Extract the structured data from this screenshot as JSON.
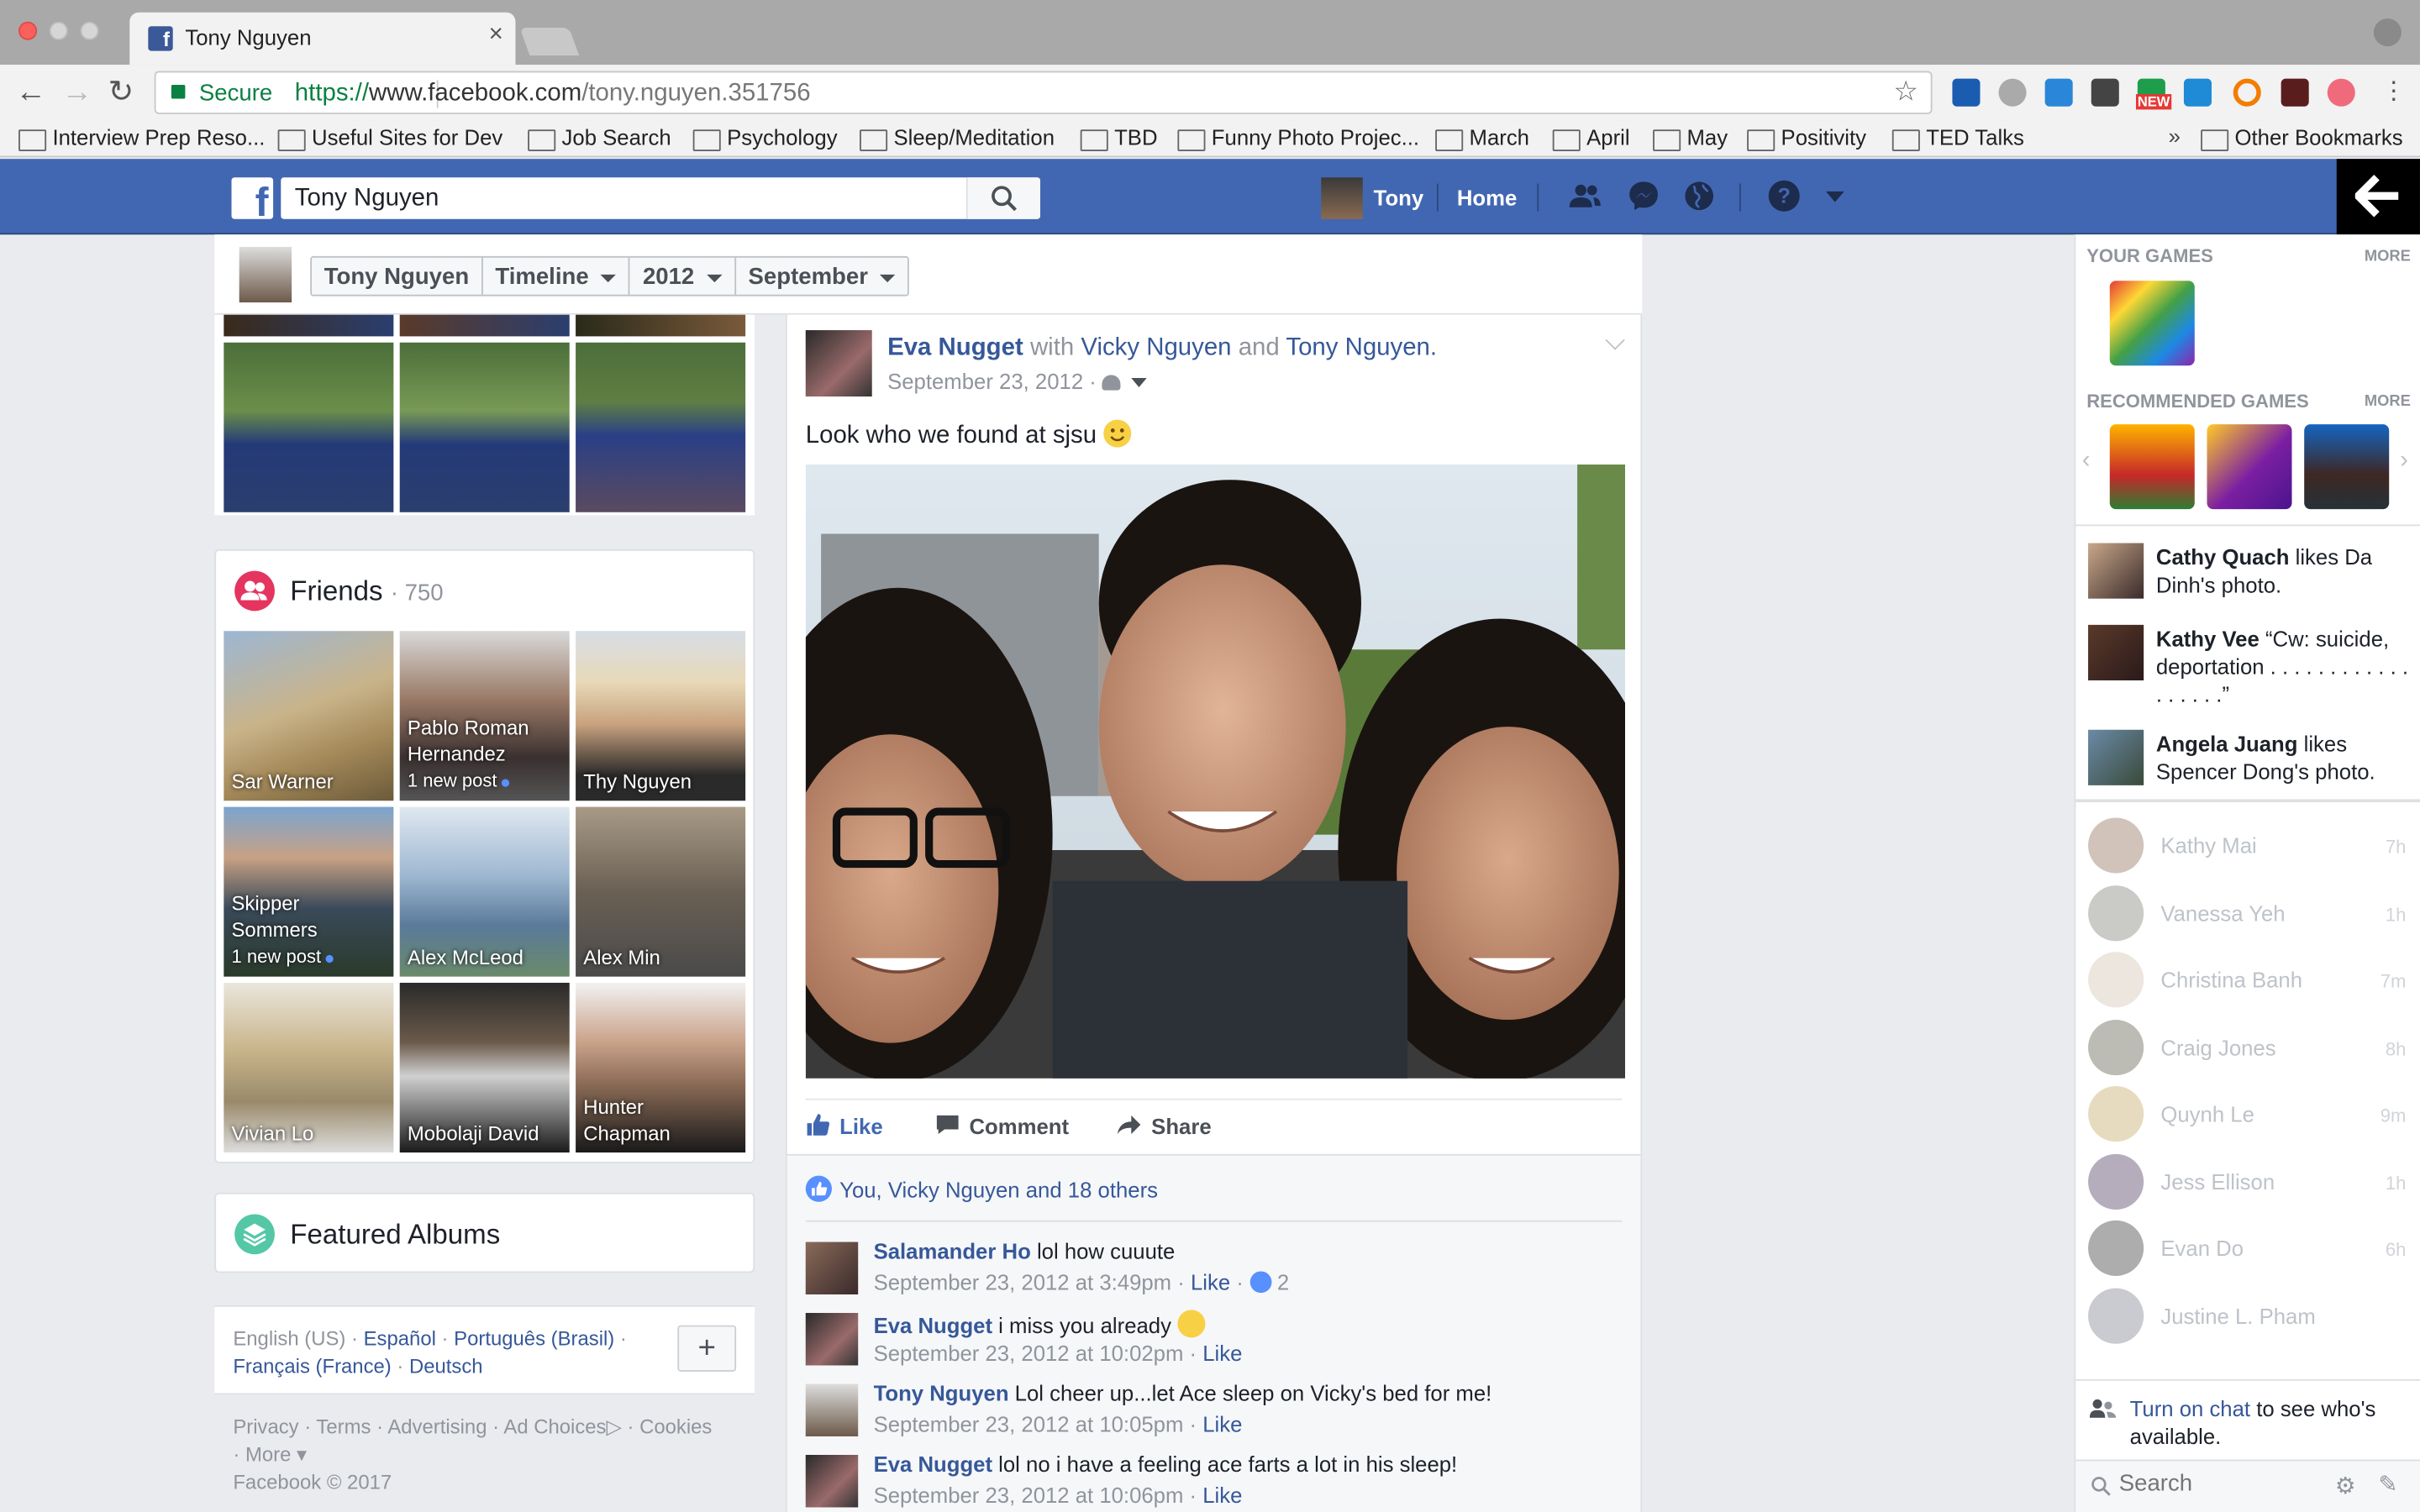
{
  "browser": {
    "tab_title": "Tony Nguyen",
    "secure_label": "Secure",
    "url_proto": "https://",
    "url_domain": "www.facebook.com",
    "url_path": "/tony.nguyen.351756",
    "bookmarks": [
      "Interview Prep Reso...",
      "Useful Sites for Dev",
      "Job Search",
      "Psychology",
      "Sleep/Meditation",
      "TBD",
      "Funny Photo Projec...",
      "March",
      "April",
      "May",
      "Positivity",
      "TED Talks"
    ],
    "bookmarks_overflow": "»",
    "other_bookmarks": "Other Bookmarks",
    "ext_new_badge": "NEW"
  },
  "fb": {
    "search_value": "Tony Nguyen",
    "user_name": "Tony",
    "home_label": "Home",
    "brand_color": "#4267b2"
  },
  "timeline_nav": {
    "crumbs": [
      "Tony Nguyen",
      "Timeline",
      "2012",
      "September"
    ]
  },
  "friends": {
    "title": "Friends",
    "count": "· 750",
    "items": [
      {
        "name": "Sar Warner"
      },
      {
        "name": "Pablo Roman Hernandez",
        "note": "1 new post"
      },
      {
        "name": "Thy Nguyen"
      },
      {
        "name": "Skipper Sommers",
        "note": "1 new post"
      },
      {
        "name": "Alex McLeod"
      },
      {
        "name": "Alex Min"
      },
      {
        "name": "Vivian Lo"
      },
      {
        "name": "Mobolaji David"
      },
      {
        "name": "Hunter Chapman"
      }
    ]
  },
  "albums": {
    "title": "Featured Albums"
  },
  "languages": {
    "current": "English (US) ·",
    "links": [
      "Español",
      "Português (Brasil)",
      "Français (France)",
      "Deutsch"
    ]
  },
  "footer": {
    "links": [
      "Privacy",
      "Terms",
      "Advertising",
      "Ad Choices",
      "Cookies",
      "More"
    ],
    "copyright": "Facebook © 2017"
  },
  "post": {
    "author": "Eva Nugget",
    "with": "with",
    "tag1": "Vicky Nguyen",
    "and": "and",
    "tag2": "Tony Nguyen.",
    "date": "September 23, 2012 ·",
    "message": "Look who we found at sjsu",
    "actions": [
      "Like",
      "Comment",
      "Share"
    ],
    "likes": "You, Vicky Nguyen and 18 others",
    "comments": [
      {
        "author": "Salamander Ho",
        "text": " lol how cuuute",
        "time": "September 23, 2012 at 3:49pm · ",
        "like": "Like",
        "reactions": "2"
      },
      {
        "author": "Eva Nugget",
        "text": " i miss you already",
        "time": "September 23, 2012 at 10:02pm · ",
        "like": "Like"
      },
      {
        "author": "Tony Nguyen",
        "text": " Lol cheer up...let Ace sleep on Vicky's bed for me!",
        "time": "September 23, 2012 at 10:05pm · ",
        "like": "Like"
      },
      {
        "author": "Eva Nugget",
        "text": " lol no i have a feeling ace farts a lot in his sleep!",
        "time": "September 23, 2012 at 10:06pm · ",
        "like": "Like"
      }
    ]
  },
  "sidebar": {
    "your_games": "YOUR GAMES",
    "recommended": "RECOMMENDED GAMES",
    "more": "MORE",
    "ticker": [
      {
        "name": "Cathy Quach",
        "text": " likes Da Dinh's photo."
      },
      {
        "name": "Kathy Vee",
        "text": " “Cw: suicide, deportation . . . . . . . . . . . . . . . . . .”"
      },
      {
        "name": "Angela Juang",
        "text": " likes Spencer Dong's photo."
      }
    ],
    "chat": [
      {
        "name": "Kathy Mai",
        "time": "7h"
      },
      {
        "name": "Vanessa Yeh",
        "time": "1h"
      },
      {
        "name": "Christina Banh",
        "time": "7m"
      },
      {
        "name": "Craig Jones",
        "time": "8h"
      },
      {
        "name": "Quynh Le",
        "time": "9m"
      },
      {
        "name": "Jess Ellison",
        "time": "1h"
      },
      {
        "name": "Evan Do",
        "time": "6h"
      },
      {
        "name": "Justine L. Pham",
        "time": ""
      }
    ],
    "chat_on_link": "Turn on chat",
    "chat_on_rest": " to see who's available.",
    "search_placeholder": "Search"
  }
}
